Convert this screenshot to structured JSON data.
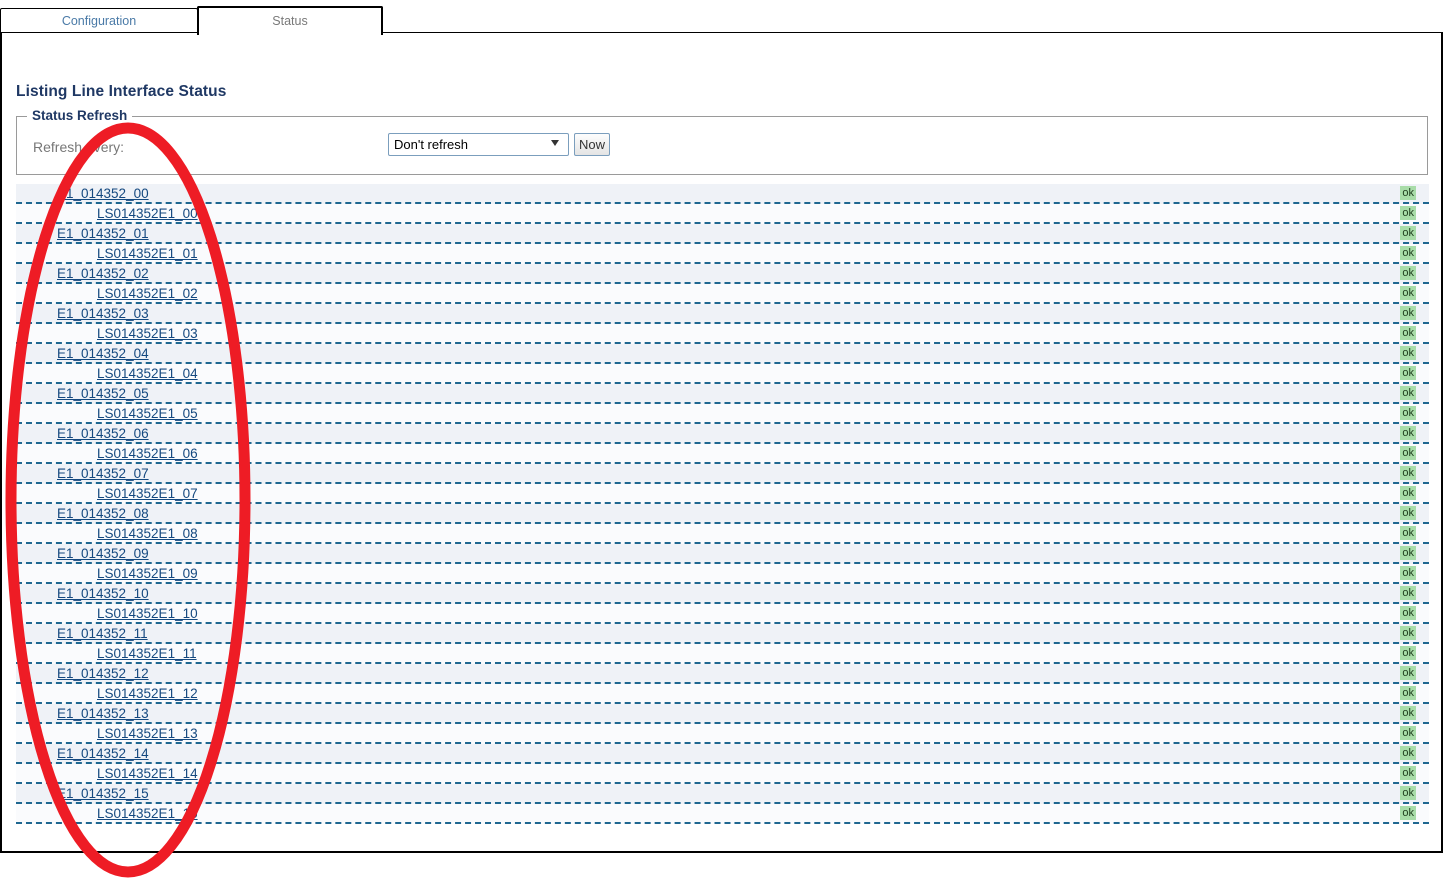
{
  "tabs": [
    {
      "label": "Configuration",
      "active": false
    },
    {
      "label": "Status",
      "active": true
    }
  ],
  "page": {
    "title": "Listing Line Interface Status"
  },
  "status_refresh": {
    "legend": "Status Refresh",
    "refresh_label": "Refresh every:",
    "select_value": "Don't refresh",
    "select_options": [
      "Don't refresh"
    ],
    "now_button": "Now"
  },
  "interfaces": [
    {
      "label": "E1_014352_00",
      "level": 0,
      "status": "ok"
    },
    {
      "label": "LS014352E1_00",
      "level": 1,
      "status": "ok"
    },
    {
      "label": "E1_014352_01",
      "level": 0,
      "status": "ok"
    },
    {
      "label": "LS014352E1_01",
      "level": 1,
      "status": "ok"
    },
    {
      "label": "E1_014352_02",
      "level": 0,
      "status": "ok"
    },
    {
      "label": "LS014352E1_02",
      "level": 1,
      "status": "ok"
    },
    {
      "label": "E1_014352_03",
      "level": 0,
      "status": "ok"
    },
    {
      "label": "LS014352E1_03",
      "level": 1,
      "status": "ok"
    },
    {
      "label": "E1_014352_04",
      "level": 0,
      "status": "ok"
    },
    {
      "label": "LS014352E1_04",
      "level": 1,
      "status": "ok"
    },
    {
      "label": "E1_014352_05",
      "level": 0,
      "status": "ok"
    },
    {
      "label": "LS014352E1_05",
      "level": 1,
      "status": "ok"
    },
    {
      "label": "E1_014352_06",
      "level": 0,
      "status": "ok"
    },
    {
      "label": "LS014352E1_06",
      "level": 1,
      "status": "ok"
    },
    {
      "label": "E1_014352_07",
      "level": 0,
      "status": "ok"
    },
    {
      "label": "LS014352E1_07",
      "level": 1,
      "status": "ok"
    },
    {
      "label": "E1_014352_08",
      "level": 0,
      "status": "ok"
    },
    {
      "label": "LS014352E1_08",
      "level": 1,
      "status": "ok"
    },
    {
      "label": "E1_014352_09",
      "level": 0,
      "status": "ok"
    },
    {
      "label": "LS014352E1_09",
      "level": 1,
      "status": "ok"
    },
    {
      "label": "E1_014352_10",
      "level": 0,
      "status": "ok"
    },
    {
      "label": "LS014352E1_10",
      "level": 1,
      "status": "ok"
    },
    {
      "label": "E1_014352_11",
      "level": 0,
      "status": "ok"
    },
    {
      "label": "LS014352E1_11",
      "level": 1,
      "status": "ok"
    },
    {
      "label": "E1_014352_12",
      "level": 0,
      "status": "ok"
    },
    {
      "label": "LS014352E1_12",
      "level": 1,
      "status": "ok"
    },
    {
      "label": "E1_014352_13",
      "level": 0,
      "status": "ok"
    },
    {
      "label": "LS014352E1_13",
      "level": 1,
      "status": "ok"
    },
    {
      "label": "E1_014352_14",
      "level": 0,
      "status": "ok"
    },
    {
      "label": "LS014352E1_14",
      "level": 1,
      "status": "ok"
    },
    {
      "label": "E1_014352_15",
      "level": 0,
      "status": "ok"
    },
    {
      "label": "LS014352E1_15",
      "level": 1,
      "status": "ok"
    }
  ],
  "annotation": {
    "shape": "ellipse",
    "color": "#ee1c25"
  },
  "colors": {
    "link": "#14487f",
    "heading": "#1f3864",
    "row_alt": "#eff2f7",
    "row_base": "#fafbfd",
    "row_divider": "#1f6790",
    "badge_bg": "#a8dca8",
    "badge_text": "#20401f",
    "annotation": "#ee1c25"
  }
}
